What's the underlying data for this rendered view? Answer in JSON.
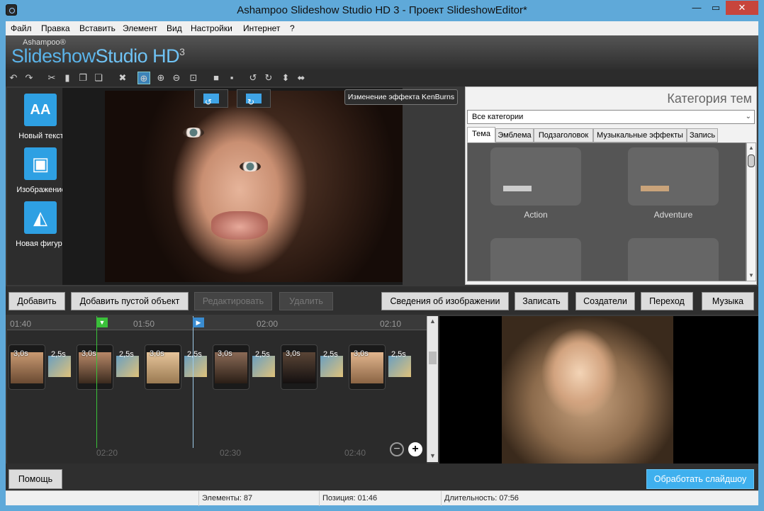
{
  "window": {
    "title": "Ashampoo Slideshow Studio HD 3 - Проект SlideshowEditor*",
    "min": "—",
    "max": "▭",
    "close": "✕"
  },
  "menu": [
    "Файл",
    "Правка",
    "Вставить",
    "Элемент",
    "Вид",
    "Настройки",
    "Интернет",
    "?"
  ],
  "brand": {
    "small": "Ashampoo®",
    "part1": "Slideshow",
    "part2": "Studio HD",
    "version": "3"
  },
  "left_tools": [
    {
      "label": "Новый текст",
      "icon": "text-icon",
      "glyph": "AA"
    },
    {
      "label": "Изображение",
      "icon": "image-icon",
      "glyph": "▣"
    },
    {
      "label": "Новая фигура",
      "icon": "shape-icon",
      "glyph": "◭"
    }
  ],
  "preview": {
    "kenburns_label": "Изменение эффекта KenBurns"
  },
  "right_panel": {
    "title": "Категория тем",
    "select_value": "Все категории",
    "tabs": [
      "Тема",
      "Эмблема",
      "Подзаголовок",
      "Музыкальные эффекты",
      "Запись"
    ],
    "active_tab": "Тема",
    "themes": [
      "Action",
      "Adventure"
    ]
  },
  "mid_buttons": {
    "add": "Добавить",
    "add_empty": "Добавить пустой объект",
    "edit": "Редактировать",
    "delete": "Удалить",
    "image_info": "Сведения об изображении",
    "record": "Записать",
    "creators": "Создатели",
    "transition": "Переход",
    "music": "Музыка"
  },
  "timeline": {
    "top_ticks": [
      "01:40",
      "01:50",
      "02:00",
      "02:10"
    ],
    "bottom_ticks": [
      "02:20",
      "02:30",
      "02:40"
    ],
    "slides": [
      {
        "duration": "3,0s"
      },
      {
        "duration": "3,0s"
      },
      {
        "duration": "3,0s"
      },
      {
        "duration": "3,0s"
      },
      {
        "duration": "3,0s"
      },
      {
        "duration": "3,0s"
      }
    ],
    "transitions": [
      "2,5s",
      "2,5s",
      "2,5s",
      "2,5s",
      "2,5s",
      "2,5s"
    ],
    "zoom_out": "−",
    "zoom_in": "+"
  },
  "bottom": {
    "help": "Помощь",
    "process": "Обработать слайдшоу"
  },
  "status": {
    "elements": "Элементы: 87",
    "position": "Позиция: 01:46",
    "duration": "Длительность: 07:56"
  },
  "colors": {
    "accent": "#2ea0e3",
    "titlebar": "#5fa9d9",
    "dark": "#2f2f2f",
    "close": "#c7453c"
  }
}
